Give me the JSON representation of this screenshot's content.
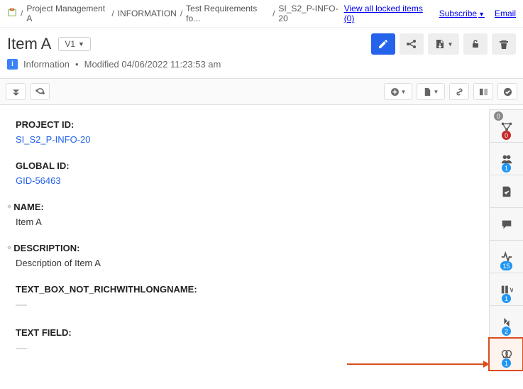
{
  "breadcrumb": {
    "items": [
      "Project Management A",
      "INFORMATION",
      "Test Requirements fo...",
      "SI_S2_P-INFO-20"
    ]
  },
  "top_right": {
    "locked": "View all locked items (0)",
    "subscribe": "Subscribe",
    "email": "Email"
  },
  "header": {
    "title": "Item A",
    "version": "V1"
  },
  "meta": {
    "type": "Information",
    "modified": "Modified 04/06/2022 11:23:53 am"
  },
  "fields": {
    "project_id": {
      "label": "PROJECT ID:",
      "value": "SI_S2_P-INFO-20"
    },
    "global_id": {
      "label": "GLOBAL ID:",
      "value": "GID-56463"
    },
    "name": {
      "label": "NAME:",
      "value": "Item A"
    },
    "description": {
      "label": "DESCRIPTION:",
      "value": "Description of Item A"
    },
    "textbox": {
      "label": "TEXT_BOX_NOT_RICHWITHLONGNAME:",
      "value": "—"
    },
    "textfield": {
      "label": "TEXT FIELD:",
      "value": "—"
    }
  },
  "rail": {
    "relationships": {
      "badge_top": "0",
      "badge": "0"
    },
    "users": {
      "badge": "1"
    },
    "attach": {
      "badge": ""
    },
    "comments": {
      "badge": ""
    },
    "activity": {
      "badge": "15"
    },
    "versions": {
      "badge": "1"
    },
    "reuse": {
      "badge": "2"
    },
    "ideas": {
      "badge": "1"
    }
  }
}
